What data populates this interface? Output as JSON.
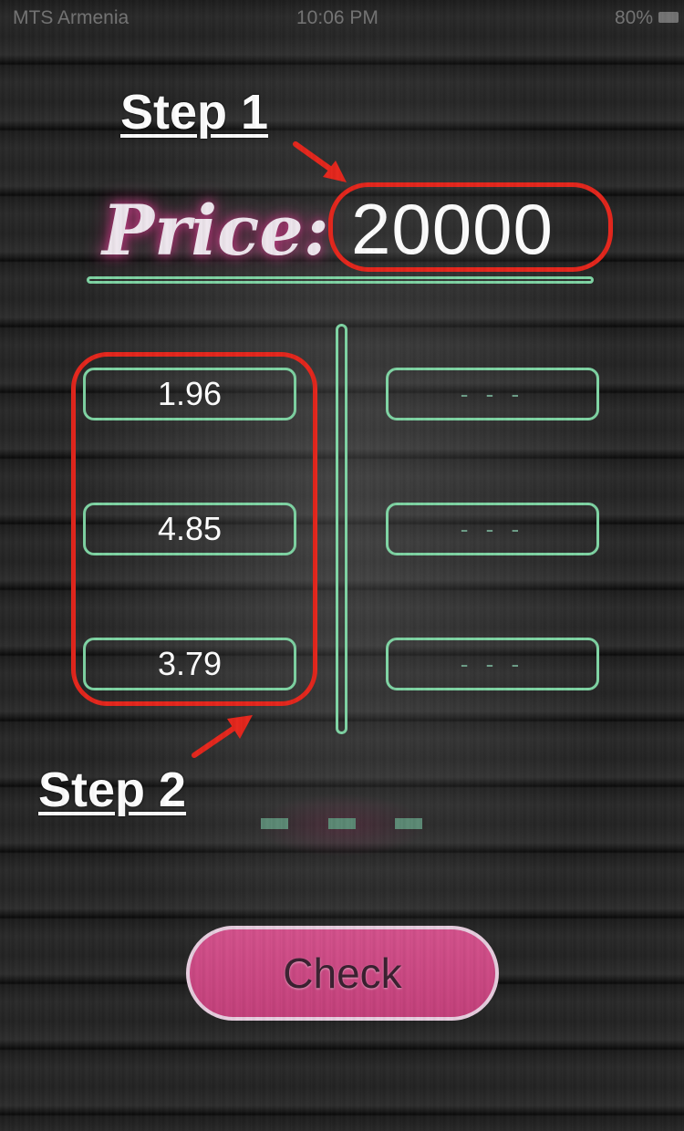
{
  "status_bar": {
    "carrier": "MTS Armenia",
    "time": "10:06 PM",
    "battery": "80%"
  },
  "annotations": {
    "step1": "Step 1",
    "step2": "Step 2",
    "highlight_color": "#e6261c"
  },
  "price": {
    "label": "Price:",
    "value": "20000"
  },
  "inputs": {
    "left": [
      "1.96",
      "4.85",
      "3.79"
    ],
    "right": [
      "- - -",
      "- - -",
      "- - -"
    ]
  },
  "result_placeholder": "- - -",
  "check_button_label": "Check",
  "colors": {
    "accent_green": "#7fd5a4",
    "button_pink": "#c94582",
    "price_glow": "#d23c8c"
  }
}
